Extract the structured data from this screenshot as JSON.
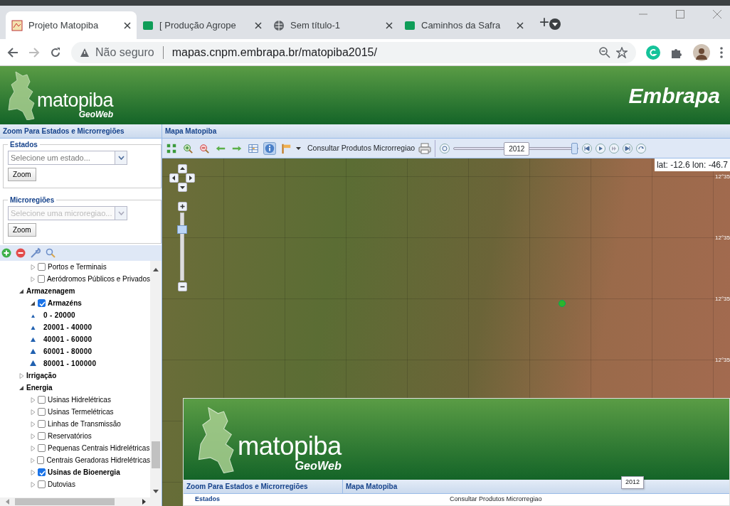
{
  "browser": {
    "tabs": [
      {
        "title": "Projeto Matopiba",
        "selected": true,
        "kind": "map"
      },
      {
        "title": "[ Produção Agrope",
        "selected": false,
        "kind": "sheet"
      },
      {
        "title": "Sem título-1",
        "selected": false,
        "kind": "globe"
      },
      {
        "title": "Caminhos da Safra",
        "selected": false,
        "kind": "sheet"
      }
    ],
    "new_tab": "+",
    "security": "Não seguro",
    "url": "mapas.cnpm.embrapa.br/matopiba2015/"
  },
  "header": {
    "logo": "matopiba",
    "logo_sub": "GeoWeb",
    "partner": "Embrapa"
  },
  "left_panel": {
    "title": "Zoom Para Estados e Microrregiões",
    "states": {
      "legend": "Estados",
      "placeholder": "Selecione um estado...",
      "button": "Zoom",
      "disabled": false
    },
    "microregions": {
      "legend": "Microregiões",
      "placeholder": "Selecione uma microregiao...",
      "button": "Zoom",
      "disabled": true
    },
    "tree": [
      {
        "kind": "group",
        "children": [
          {
            "kind": "layer",
            "label": "Portos e Terminais",
            "checked": false,
            "expanded": false
          },
          {
            "kind": "layer",
            "label": "Aeródromos Públicos e Privados",
            "checked": false,
            "expanded": false
          }
        ]
      },
      {
        "kind": "group",
        "label": "Armazenagem",
        "expanded": true,
        "children": [
          {
            "kind": "layer",
            "label": "Armazéns",
            "checked": true,
            "expanded": true,
            "children": [
              {
                "kind": "legend",
                "label": "0 - 20000"
              },
              {
                "kind": "legend",
                "label": "20001 - 40000"
              },
              {
                "kind": "legend",
                "label": "40001 - 60000"
              },
              {
                "kind": "legend",
                "label": "60001 - 80000"
              },
              {
                "kind": "legend",
                "label": "80001 - 100000"
              }
            ]
          }
        ]
      },
      {
        "kind": "group",
        "label": "Irrigação",
        "expanded": false
      },
      {
        "kind": "group",
        "label": "Energia",
        "expanded": true,
        "children": [
          {
            "kind": "layer",
            "label": "Usinas Hidrelétricas",
            "checked": false,
            "expanded": false
          },
          {
            "kind": "layer",
            "label": "Usinas Termelétricas",
            "checked": false,
            "expanded": false
          },
          {
            "kind": "layer",
            "label": "Linhas de Transmissão",
            "checked": false,
            "expanded": false
          },
          {
            "kind": "layer",
            "label": "Reservatórios",
            "checked": false,
            "expanded": false
          },
          {
            "kind": "layer",
            "label": "Pequenas Centrais Hidrelétricas",
            "checked": false,
            "expanded": false
          },
          {
            "kind": "layer",
            "label": "Centrais Geradoras Hidrelétricas",
            "checked": false,
            "expanded": false
          },
          {
            "kind": "layer",
            "label": "Usinas de Bioenergia",
            "checked": true,
            "expanded": false
          },
          {
            "kind": "layer",
            "label": "Dutovias",
            "checked": false,
            "expanded": false
          }
        ]
      }
    ]
  },
  "map_panel": {
    "title": "Mapa Matopiba",
    "tools": [
      {
        "kind": "extent",
        "selected": false
      },
      {
        "kind": "zoomin",
        "selected": false
      },
      {
        "kind": "zoomout",
        "selected": false
      },
      {
        "kind": "back",
        "selected": false
      },
      {
        "kind": "forward",
        "selected": false
      },
      {
        "kind": "table",
        "selected": false
      },
      {
        "kind": "info",
        "selected": true
      },
      {
        "kind": "flag",
        "selected": false
      }
    ],
    "query_label": "Consultar Produtos Microrregiao",
    "time_slider": {
      "label": "2012",
      "level": 1
    },
    "zoom_slider": {
      "level": 0.8
    },
    "coords": "lat: -12.6 lon: -46.7",
    "grid_labels": [
      "12°35",
      "12°35",
      "12°35",
      "12°35"
    ]
  },
  "embedded_screenshot": {
    "logo": "matopiba",
    "logo_sub": "GeoWeb",
    "left_title": "Zoom Para Estados e Microrregiões",
    "right_title": "Mapa Matopiba",
    "legend": "Estados",
    "query_label": "Consultar Produtos Microrregiao",
    "tooltip": "2012"
  }
}
